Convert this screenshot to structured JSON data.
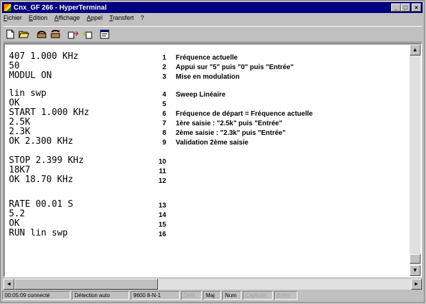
{
  "window": {
    "title": "Cnx_GF 266 - HyperTerminal"
  },
  "title_buttons": [
    "_",
    "□",
    "×"
  ],
  "menu": [
    "Fichier",
    "Edition",
    "Affichage",
    "Appel",
    "Transfert",
    "?"
  ],
  "toolbar_icons": [
    "new-icon",
    "open-icon",
    "call-icon",
    "disconnect-icon",
    "send-icon",
    "receive-icon",
    "properties-icon"
  ],
  "terminal_lines": [
    {
      "cmd": "407 1.000 KHz",
      "num": "1",
      "desc": "Fréquence actuelle"
    },
    {
      "cmd": "50",
      "num": "2",
      "desc": "Appui sur \"5\" puis \"0\" puis \"Entrée\""
    },
    {
      "cmd": "MODUL ON",
      "num": "3",
      "desc": "Mise en modulation"
    },
    {
      "cmd": "lin swp",
      "num": "4",
      "desc": "Sweep Linéaire"
    },
    {
      "cmd": "OK",
      "num": "5",
      "desc": ""
    },
    {
      "cmd": "START 1.000 KHz",
      "num": "6",
      "desc": "Fréquence de départ = Fréquence actuelle"
    },
    {
      "cmd": "2.5K",
      "num": "7",
      "desc": "1ère saisie : \"2.5k\" puis \"Entrée\""
    },
    {
      "cmd": "2.3K",
      "num": "8",
      "desc": "2ème saisie : \"2.3k\" puis \"Entrée\""
    },
    {
      "cmd": "OK 2.300 KHz",
      "num": "9",
      "desc": "Validation 2ème saisie"
    },
    {
      "cmd": "STOP 2.399 KHz",
      "num": "10",
      "desc": ""
    },
    {
      "cmd": "18K7",
      "num": "11",
      "desc": ""
    },
    {
      "cmd": "OK 18.70 KHz",
      "num": "12",
      "desc": ""
    },
    {
      "cmd": "RATE 00.01 S",
      "num": "13",
      "desc": ""
    },
    {
      "cmd": "5.2",
      "num": "14",
      "desc": ""
    },
    {
      "cmd": "OK",
      "num": "15",
      "desc": ""
    },
    {
      "cmd": "RUN lin swp",
      "num": "16",
      "desc": ""
    }
  ],
  "status": {
    "connected": "00:05:09 connecté",
    "detection": "Détection auto",
    "params": "9600 8-N-1",
    "defil": "Défil",
    "maj": "Maj",
    "num": "Num",
    "capturer": "Capturer",
    "echo": "Echo"
  },
  "scroll": {
    "up": "▲",
    "down": "▼",
    "left": "◄",
    "right": "►"
  }
}
